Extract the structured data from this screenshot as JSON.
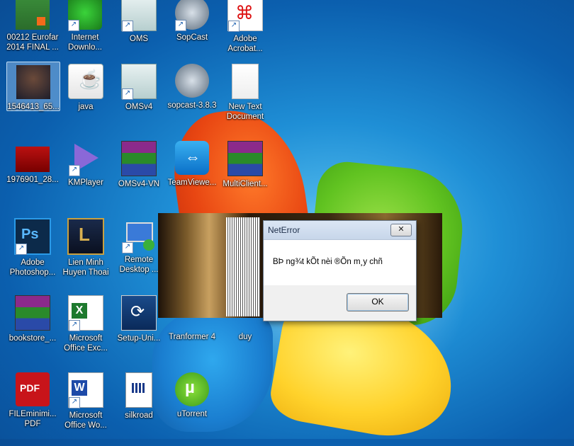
{
  "desktop": {
    "icons": [
      {
        "label": "00212 Eurofar 2014 FINAL ...",
        "icon": "file-image-icon"
      },
      {
        "label": "Internet Downlo...",
        "icon": "idm-icon"
      },
      {
        "label": "OMS",
        "icon": "oms-icon"
      },
      {
        "label": "SopCast",
        "icon": "sopcast-icon"
      },
      {
        "label": "Adobe Acrobat...",
        "icon": "adobe-acrobat-icon"
      },
      {
        "label": "1546413_65...",
        "icon": "photo-icon"
      },
      {
        "label": "java",
        "icon": "java-icon"
      },
      {
        "label": "OMSv4",
        "icon": "oms-icon"
      },
      {
        "label": "sopcast-3.8.3",
        "icon": "sopcast-icon"
      },
      {
        "label": "New Text Document",
        "icon": "text-document-icon"
      },
      {
        "label": "1976901_28...",
        "icon": "photo-icon"
      },
      {
        "label": "KMPlayer",
        "icon": "kmplayer-icon"
      },
      {
        "label": "OMSv4-VN",
        "icon": "winrar-icon"
      },
      {
        "label": "TeamViewe...",
        "icon": "teamviewer-icon"
      },
      {
        "label": "MultiClient...",
        "icon": "winrar-icon"
      },
      {
        "label": "Adobe Photoshop...",
        "icon": "photoshop-icon"
      },
      {
        "label": "Lien Minh Huyen Thoai",
        "icon": "league-icon"
      },
      {
        "label": "Remote Desktop ...",
        "icon": "remote-desktop-icon"
      },
      {
        "label": "bookstore_...",
        "icon": "winrar-icon"
      },
      {
        "label": "Microsoft Office Exc...",
        "icon": "excel-icon"
      },
      {
        "label": "Setup-Uni...",
        "icon": "setup-icon"
      },
      {
        "label": "Tranformer 4",
        "icon": "folder-icon"
      },
      {
        "label": "duy",
        "icon": "folder-icon"
      },
      {
        "label": "FILEminimi... PDF",
        "icon": "pdf-icon"
      },
      {
        "label": "Microsoft Office Wo...",
        "icon": "word-icon"
      },
      {
        "label": "silkroad",
        "icon": "config-file-icon"
      },
      {
        "label": "uTorrent",
        "icon": "utorrent-icon"
      }
    ]
  },
  "dialog": {
    "title": "NetError",
    "message": "BÞ ng¾t kÕt nèi ®Õn m¸y chñ",
    "ok_label": "OK",
    "close_label": "✕"
  }
}
